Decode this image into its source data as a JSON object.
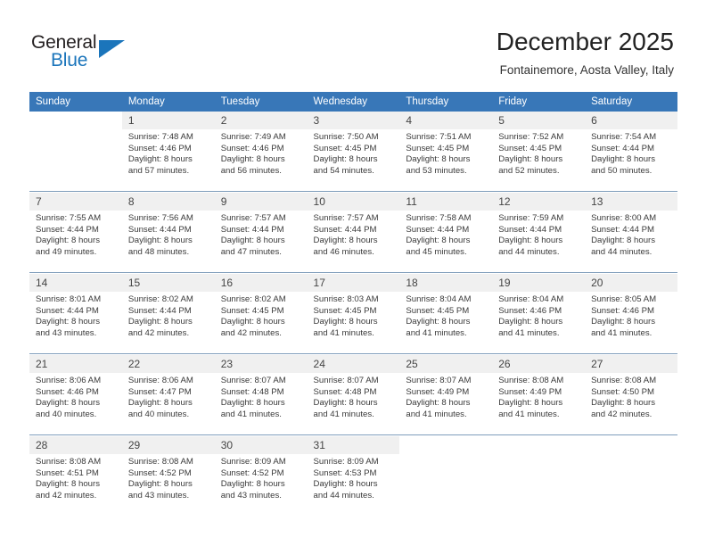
{
  "brand": {
    "name_part1": "General",
    "name_part2": "Blue",
    "triangle_color": "#1b75bb"
  },
  "header": {
    "title": "December 2025",
    "subtitle": "Fontainemore, Aosta Valley, Italy"
  },
  "theme": {
    "header_row_bg": "#3877b8",
    "header_row_text": "#ffffff",
    "daynum_bg": "#f0f0f0",
    "cell_bg": "#ffffff",
    "separator": "#7f9dbb"
  },
  "weekdays": [
    "Sunday",
    "Monday",
    "Tuesday",
    "Wednesday",
    "Thursday",
    "Friday",
    "Saturday"
  ],
  "weeks": [
    {
      "days": [
        {
          "day": "",
          "sunrise": "",
          "sunset": "",
          "daylight_line1": "",
          "daylight_line2": "",
          "empty": true
        },
        {
          "day": "1",
          "sunrise": "Sunrise: 7:48 AM",
          "sunset": "Sunset: 4:46 PM",
          "daylight_line1": "Daylight: 8 hours",
          "daylight_line2": "and 57 minutes.",
          "empty": false
        },
        {
          "day": "2",
          "sunrise": "Sunrise: 7:49 AM",
          "sunset": "Sunset: 4:46 PM",
          "daylight_line1": "Daylight: 8 hours",
          "daylight_line2": "and 56 minutes.",
          "empty": false
        },
        {
          "day": "3",
          "sunrise": "Sunrise: 7:50 AM",
          "sunset": "Sunset: 4:45 PM",
          "daylight_line1": "Daylight: 8 hours",
          "daylight_line2": "and 54 minutes.",
          "empty": false
        },
        {
          "day": "4",
          "sunrise": "Sunrise: 7:51 AM",
          "sunset": "Sunset: 4:45 PM",
          "daylight_line1": "Daylight: 8 hours",
          "daylight_line2": "and 53 minutes.",
          "empty": false
        },
        {
          "day": "5",
          "sunrise": "Sunrise: 7:52 AM",
          "sunset": "Sunset: 4:45 PM",
          "daylight_line1": "Daylight: 8 hours",
          "daylight_line2": "and 52 minutes.",
          "empty": false
        },
        {
          "day": "6",
          "sunrise": "Sunrise: 7:54 AM",
          "sunset": "Sunset: 4:44 PM",
          "daylight_line1": "Daylight: 8 hours",
          "daylight_line2": "and 50 minutes.",
          "empty": false
        }
      ]
    },
    {
      "days": [
        {
          "day": "7",
          "sunrise": "Sunrise: 7:55 AM",
          "sunset": "Sunset: 4:44 PM",
          "daylight_line1": "Daylight: 8 hours",
          "daylight_line2": "and 49 minutes.",
          "empty": false
        },
        {
          "day": "8",
          "sunrise": "Sunrise: 7:56 AM",
          "sunset": "Sunset: 4:44 PM",
          "daylight_line1": "Daylight: 8 hours",
          "daylight_line2": "and 48 minutes.",
          "empty": false
        },
        {
          "day": "9",
          "sunrise": "Sunrise: 7:57 AM",
          "sunset": "Sunset: 4:44 PM",
          "daylight_line1": "Daylight: 8 hours",
          "daylight_line2": "and 47 minutes.",
          "empty": false
        },
        {
          "day": "10",
          "sunrise": "Sunrise: 7:57 AM",
          "sunset": "Sunset: 4:44 PM",
          "daylight_line1": "Daylight: 8 hours",
          "daylight_line2": "and 46 minutes.",
          "empty": false
        },
        {
          "day": "11",
          "sunrise": "Sunrise: 7:58 AM",
          "sunset": "Sunset: 4:44 PM",
          "daylight_line1": "Daylight: 8 hours",
          "daylight_line2": "and 45 minutes.",
          "empty": false
        },
        {
          "day": "12",
          "sunrise": "Sunrise: 7:59 AM",
          "sunset": "Sunset: 4:44 PM",
          "daylight_line1": "Daylight: 8 hours",
          "daylight_line2": "and 44 minutes.",
          "empty": false
        },
        {
          "day": "13",
          "sunrise": "Sunrise: 8:00 AM",
          "sunset": "Sunset: 4:44 PM",
          "daylight_line1": "Daylight: 8 hours",
          "daylight_line2": "and 44 minutes.",
          "empty": false
        }
      ]
    },
    {
      "days": [
        {
          "day": "14",
          "sunrise": "Sunrise: 8:01 AM",
          "sunset": "Sunset: 4:44 PM",
          "daylight_line1": "Daylight: 8 hours",
          "daylight_line2": "and 43 minutes.",
          "empty": false
        },
        {
          "day": "15",
          "sunrise": "Sunrise: 8:02 AM",
          "sunset": "Sunset: 4:44 PM",
          "daylight_line1": "Daylight: 8 hours",
          "daylight_line2": "and 42 minutes.",
          "empty": false
        },
        {
          "day": "16",
          "sunrise": "Sunrise: 8:02 AM",
          "sunset": "Sunset: 4:45 PM",
          "daylight_line1": "Daylight: 8 hours",
          "daylight_line2": "and 42 minutes.",
          "empty": false
        },
        {
          "day": "17",
          "sunrise": "Sunrise: 8:03 AM",
          "sunset": "Sunset: 4:45 PM",
          "daylight_line1": "Daylight: 8 hours",
          "daylight_line2": "and 41 minutes.",
          "empty": false
        },
        {
          "day": "18",
          "sunrise": "Sunrise: 8:04 AM",
          "sunset": "Sunset: 4:45 PM",
          "daylight_line1": "Daylight: 8 hours",
          "daylight_line2": "and 41 minutes.",
          "empty": false
        },
        {
          "day": "19",
          "sunrise": "Sunrise: 8:04 AM",
          "sunset": "Sunset: 4:46 PM",
          "daylight_line1": "Daylight: 8 hours",
          "daylight_line2": "and 41 minutes.",
          "empty": false
        },
        {
          "day": "20",
          "sunrise": "Sunrise: 8:05 AM",
          "sunset": "Sunset: 4:46 PM",
          "daylight_line1": "Daylight: 8 hours",
          "daylight_line2": "and 41 minutes.",
          "empty": false
        }
      ]
    },
    {
      "days": [
        {
          "day": "21",
          "sunrise": "Sunrise: 8:06 AM",
          "sunset": "Sunset: 4:46 PM",
          "daylight_line1": "Daylight: 8 hours",
          "daylight_line2": "and 40 minutes.",
          "empty": false
        },
        {
          "day": "22",
          "sunrise": "Sunrise: 8:06 AM",
          "sunset": "Sunset: 4:47 PM",
          "daylight_line1": "Daylight: 8 hours",
          "daylight_line2": "and 40 minutes.",
          "empty": false
        },
        {
          "day": "23",
          "sunrise": "Sunrise: 8:07 AM",
          "sunset": "Sunset: 4:48 PM",
          "daylight_line1": "Daylight: 8 hours",
          "daylight_line2": "and 41 minutes.",
          "empty": false
        },
        {
          "day": "24",
          "sunrise": "Sunrise: 8:07 AM",
          "sunset": "Sunset: 4:48 PM",
          "daylight_line1": "Daylight: 8 hours",
          "daylight_line2": "and 41 minutes.",
          "empty": false
        },
        {
          "day": "25",
          "sunrise": "Sunrise: 8:07 AM",
          "sunset": "Sunset: 4:49 PM",
          "daylight_line1": "Daylight: 8 hours",
          "daylight_line2": "and 41 minutes.",
          "empty": false
        },
        {
          "day": "26",
          "sunrise": "Sunrise: 8:08 AM",
          "sunset": "Sunset: 4:49 PM",
          "daylight_line1": "Daylight: 8 hours",
          "daylight_line2": "and 41 minutes.",
          "empty": false
        },
        {
          "day": "27",
          "sunrise": "Sunrise: 8:08 AM",
          "sunset": "Sunset: 4:50 PM",
          "daylight_line1": "Daylight: 8 hours",
          "daylight_line2": "and 42 minutes.",
          "empty": false
        }
      ]
    },
    {
      "days": [
        {
          "day": "28",
          "sunrise": "Sunrise: 8:08 AM",
          "sunset": "Sunset: 4:51 PM",
          "daylight_line1": "Daylight: 8 hours",
          "daylight_line2": "and 42 minutes.",
          "empty": false
        },
        {
          "day": "29",
          "sunrise": "Sunrise: 8:08 AM",
          "sunset": "Sunset: 4:52 PM",
          "daylight_line1": "Daylight: 8 hours",
          "daylight_line2": "and 43 minutes.",
          "empty": false
        },
        {
          "day": "30",
          "sunrise": "Sunrise: 8:09 AM",
          "sunset": "Sunset: 4:52 PM",
          "daylight_line1": "Daylight: 8 hours",
          "daylight_line2": "and 43 minutes.",
          "empty": false
        },
        {
          "day": "31",
          "sunrise": "Sunrise: 8:09 AM",
          "sunset": "Sunset: 4:53 PM",
          "daylight_line1": "Daylight: 8 hours",
          "daylight_line2": "and 44 minutes.",
          "empty": false
        },
        {
          "day": "",
          "sunrise": "",
          "sunset": "",
          "daylight_line1": "",
          "daylight_line2": "",
          "empty": true
        },
        {
          "day": "",
          "sunrise": "",
          "sunset": "",
          "daylight_line1": "",
          "daylight_line2": "",
          "empty": true
        },
        {
          "day": "",
          "sunrise": "",
          "sunset": "",
          "daylight_line1": "",
          "daylight_line2": "",
          "empty": true
        }
      ]
    }
  ]
}
